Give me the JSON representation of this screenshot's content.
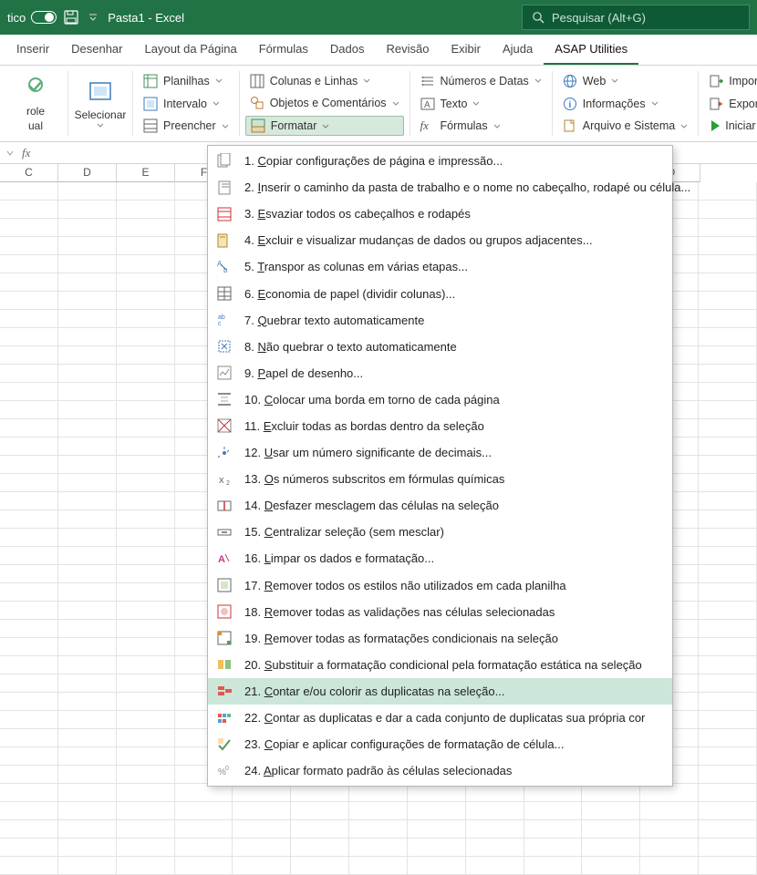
{
  "titlebar": {
    "toggle_label": "tico",
    "doc_title": "Pasta1  -  Excel",
    "search_placeholder": "Pesquisar (Alt+G)"
  },
  "tabs": [
    "Inserir",
    "Desenhar",
    "Layout da Página",
    "Fórmulas",
    "Dados",
    "Revisão",
    "Exibir",
    "Ajuda",
    "ASAP Utilities"
  ],
  "active_tab": 8,
  "ribbon": {
    "big1_line1": "role",
    "big1_line2": "ual",
    "big2": "Selecionar",
    "g1": {
      "a": "Planilhas",
      "b": "Intervalo",
      "c": "Preencher"
    },
    "g2": {
      "a": "Colunas e Linhas",
      "b": "Objetos e Comentários",
      "c": "Formatar"
    },
    "g3": {
      "a": "Números e Datas",
      "b": "Texto",
      "c": "Fórmulas"
    },
    "g4": {
      "a": "Web",
      "b": "Informações",
      "c": "Arquivo e Sistema"
    },
    "g5": {
      "a": "Importar",
      "b": "Exportar",
      "c": "Iniciar"
    }
  },
  "columns": [
    "C",
    "D",
    "E",
    "F",
    "",
    "",
    "",
    "",
    "",
    "",
    "",
    "O"
  ],
  "formula_bar": {
    "fx": "fx"
  },
  "dropdown": [
    {
      "num": "1.",
      "label": "Copiar configurações de página e impressão..."
    },
    {
      "num": "2.",
      "label": "Inserir o caminho da pasta de trabalho e o nome no cabeçalho, rodapé ou célula..."
    },
    {
      "num": "3.",
      "label": "Esvaziar todos os cabeçalhos e rodapés"
    },
    {
      "num": "4.",
      "label": "Excluir e visualizar mudanças de dados ou grupos adjacentes..."
    },
    {
      "num": "5.",
      "label": "Transpor as colunas em várias etapas..."
    },
    {
      "num": "6.",
      "label": "Economia de papel (dividir colunas)..."
    },
    {
      "num": "7.",
      "label": "Quebrar texto automaticamente"
    },
    {
      "num": "8.",
      "label": "Não quebrar o texto automaticamente"
    },
    {
      "num": "9.",
      "label": "Papel de desenho..."
    },
    {
      "num": "10.",
      "label": "Colocar uma borda em torno de cada página"
    },
    {
      "num": "11.",
      "label": "Excluir todas as bordas dentro da seleção"
    },
    {
      "num": "12.",
      "label": "Usar um número significante de decimais..."
    },
    {
      "num": "13.",
      "label": "Os números subscritos em fórmulas químicas"
    },
    {
      "num": "14.",
      "label": "Desfazer mesclagem das células na seleção"
    },
    {
      "num": "15.",
      "label": "Centralizar seleção (sem mesclar)"
    },
    {
      "num": "16.",
      "label": "Limpar os dados e formatação..."
    },
    {
      "num": "17.",
      "label": "Remover todos os estilos não utilizados em cada planilha"
    },
    {
      "num": "18.",
      "label": "Remover todas as validações nas células selecionadas"
    },
    {
      "num": "19.",
      "label": "Remover todas as formatações condicionais na seleção"
    },
    {
      "num": "20.",
      "label": "Substituir a formatação condicional pela formatação estática na seleção"
    },
    {
      "num": "21.",
      "label": "Contar e/ou colorir as duplicatas na seleção..."
    },
    {
      "num": "22.",
      "label": "Contar as duplicatas e dar a cada conjunto de duplicatas sua própria cor"
    },
    {
      "num": "23.",
      "label": "Copiar e aplicar configurações de formatação de célula..."
    },
    {
      "num": "24.",
      "label": "Aplicar formato padrão às células selecionadas"
    }
  ],
  "dropdown_hover": 20
}
